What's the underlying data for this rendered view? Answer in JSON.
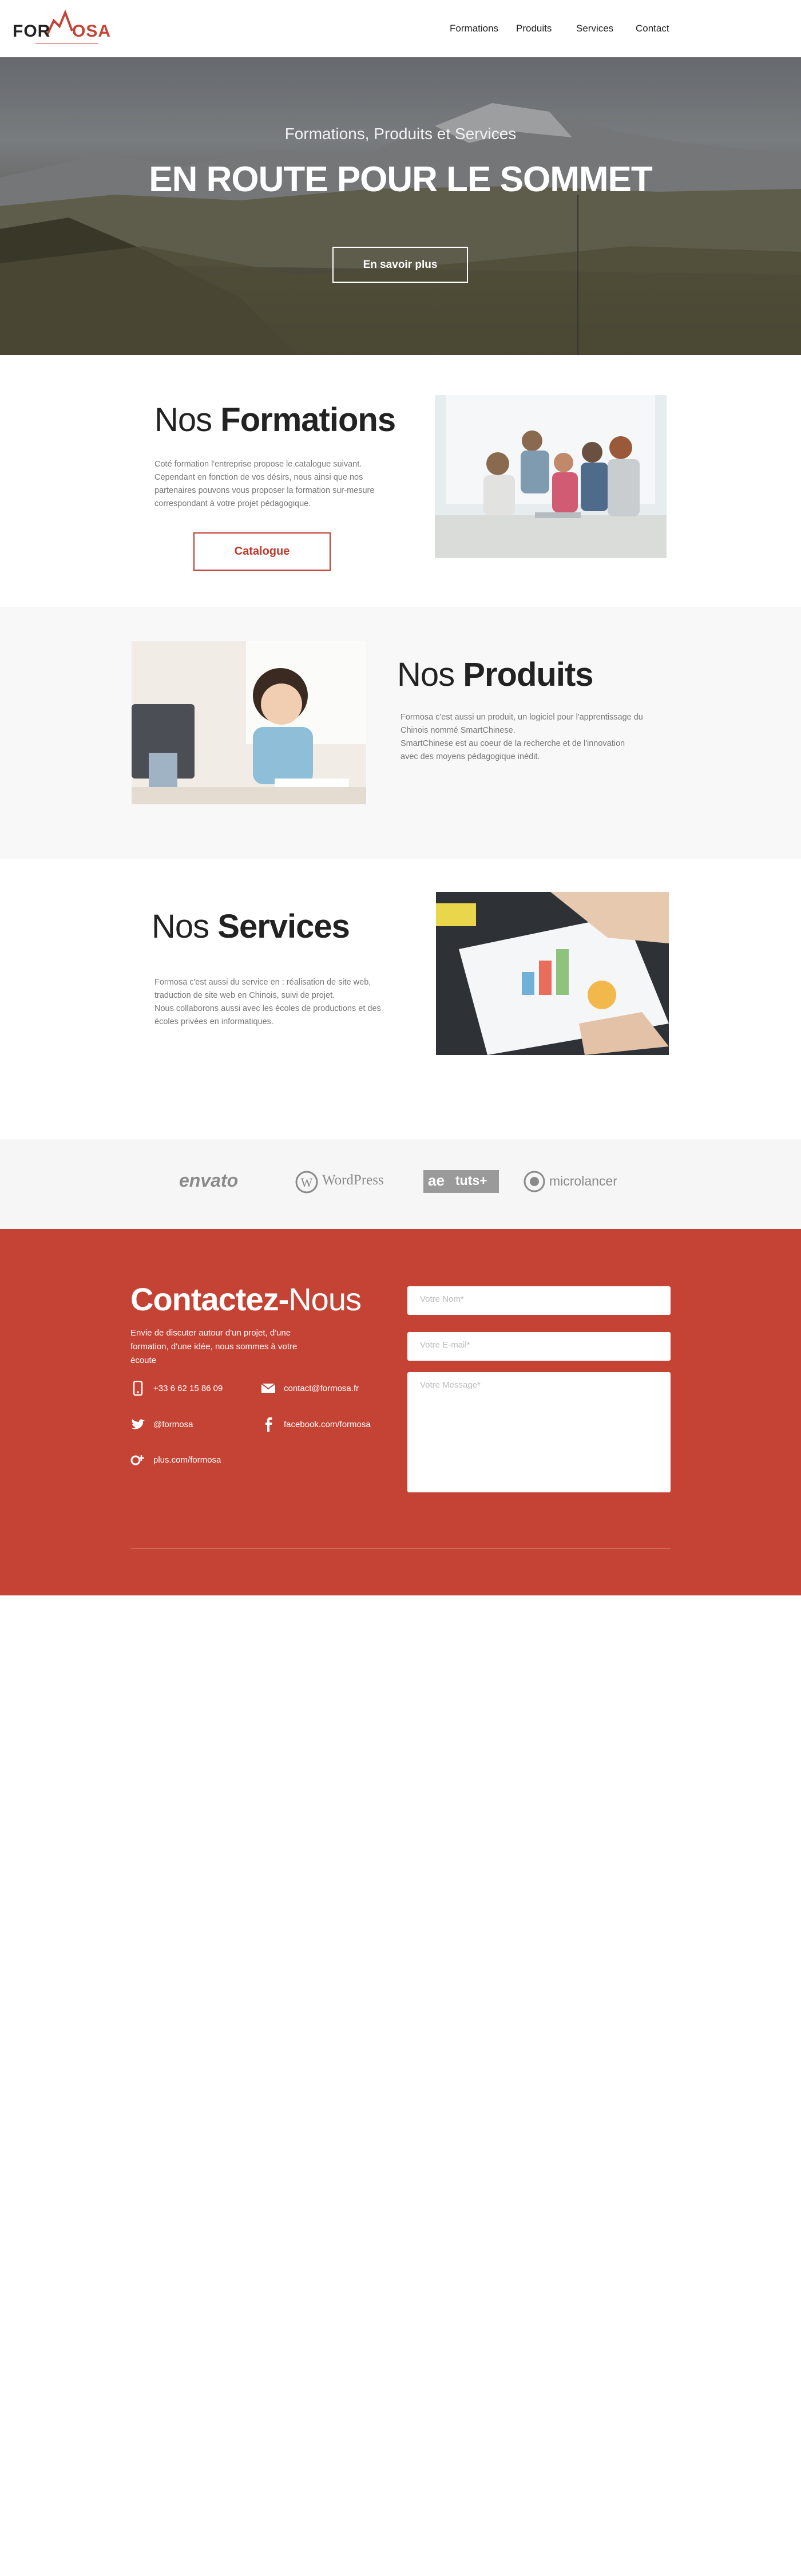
{
  "header": {
    "logo": {
      "part1": "FOR",
      "part2": "M",
      "part3": "OSA"
    },
    "nav": [
      {
        "label": "Formations"
      },
      {
        "label": "Produits"
      },
      {
        "label": "Services"
      },
      {
        "label": "Contact"
      }
    ]
  },
  "hero": {
    "subtitle": "Formations, Produits et Services",
    "title": "EN ROUTE POUR LE SOMMET",
    "button": "En savoir plus"
  },
  "formations": {
    "title_light": "Nos",
    "title_bold": "Formations",
    "text": [
      "Coté formation l'entreprise propose le catalogue suivant.",
      "Cependant en fonction de vos désirs, nous ainsi que nos",
      "partenaires pouvons vous proposer la formation sur-mesure",
      "correspondant à votre projet pédagogique."
    ],
    "button": "Catalogue"
  },
  "produits": {
    "title_light": "Nos",
    "title_bold": "Produits",
    "text": [
      "Formosa c'est aussi un produit, un logiciel pour l'apprentissage du",
      "Chinois nommé SmartChinese.",
      "SmartChinese est au coeur de la recherche et de l'innovation",
      "avec des moyens pédagogique inédit."
    ]
  },
  "services": {
    "title_light": "Nos",
    "title_bold": "Services",
    "text": [
      "Formosa c'est aussi du service en : réalisation de site web,",
      "traduction de site web en Chinois, suivi de projet.",
      "Nous collaborons aussi avec les écoles de productions et des",
      "écoles privées en informatiques."
    ]
  },
  "partners": [
    "envato",
    "WordPress",
    "tuts+",
    "microlancer"
  ],
  "contact": {
    "title_bold": "Contactez-",
    "title_light": "Nous",
    "intro": "Envie de discuter autour d'un projet, d'une formation, d'une idée, nous sommes à votre écoute",
    "phone": "+33 6 62 15 86 09",
    "email": "contact@formosa.fr",
    "twitter": "@formosa",
    "facebook": "facebook.com/formosa",
    "gplus": "plus.com/formosa",
    "form": {
      "name_placeholder": "Votre Nom*",
      "email_placeholder": "Votre E-mail*",
      "message_placeholder": "Votre Message*"
    }
  },
  "colors": {
    "accent": "#c54334",
    "light_bg": "#f6f6f6"
  }
}
